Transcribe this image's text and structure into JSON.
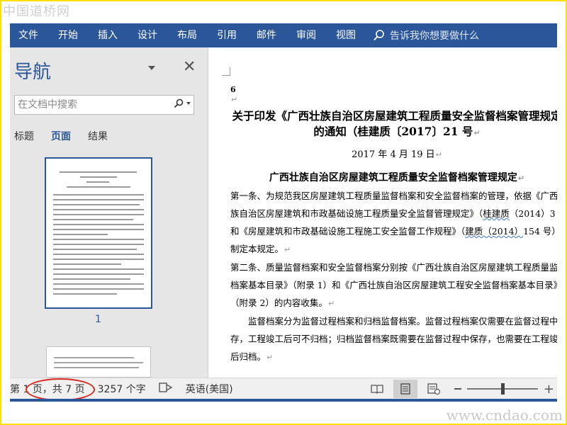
{
  "watermark": {
    "top": "中国道桥网",
    "bottom": "www.cndao.com"
  },
  "ribbon": {
    "tabs": [
      "文件",
      "开始",
      "插入",
      "设计",
      "布局",
      "引用",
      "邮件",
      "审阅",
      "视图"
    ],
    "tell_me": "告诉我你想要做什么",
    "color": "#2b579a"
  },
  "nav": {
    "title": "导航",
    "search_placeholder": "在文档中搜索",
    "tabs": [
      "标题",
      "页面",
      "结果"
    ],
    "active_tab": "页面",
    "thumbnail_page": "1"
  },
  "document": {
    "page_marker": "6",
    "title_line1": "关于印发《广西壮族自治区房屋建筑工程质量安全监督档案管理规定",
    "title_line2": "的通知（桂建质〔2017〕21 号",
    "date": "2017 年 4 月 19 日",
    "heading": "广西壮族自治区房屋建筑工程质量安全监督档案管理规定",
    "paragraphs": {
      "p1_l1": "第一条、为规范我区房屋建筑工程质量监督档案和安全监督档案的管理，依据《广西壮",
      "p1_l2": "族自治区房屋建筑和市政基础设施工程质量安全监督管理规定》（",
      "p1_l2_u": "桂建质",
      "p1_l2_end": "（2014）3 号",
      "p1_l3_start": "和《房屋建筑和市政基础设施工程施工安全监督工作规程》（",
      "p1_l3_u": "建质（2014）",
      "p1_l3_end": "154 号）",
      "p1_l4": "制定本规定。",
      "p2_l1": "第二条、质量监督档案和安全监督档案分别按《广西壮族自治区房屋建筑工程质量监督",
      "p2_l2": "档案基本目录》（附录 1）和《广西壮族自治区房屋建筑工程安全监督档案基本目录》",
      "p2_l3": "（附录 2）的内容收集。",
      "p3_l1": "监督档案分为监督过程档案和归档监督档案。监督过程档案仅需要在监督过程中保",
      "p3_l2": "存，工程竣工后可不归档；归档监督档案既需要在监督过程中保存，也需要在工程竣工",
      "p3_l3": "后归档。"
    }
  },
  "status": {
    "page_info": "第 1 页，共 7 页",
    "word_count": "3257 个字",
    "language": "英语(美国)",
    "highlight_color": "#d9281e"
  }
}
